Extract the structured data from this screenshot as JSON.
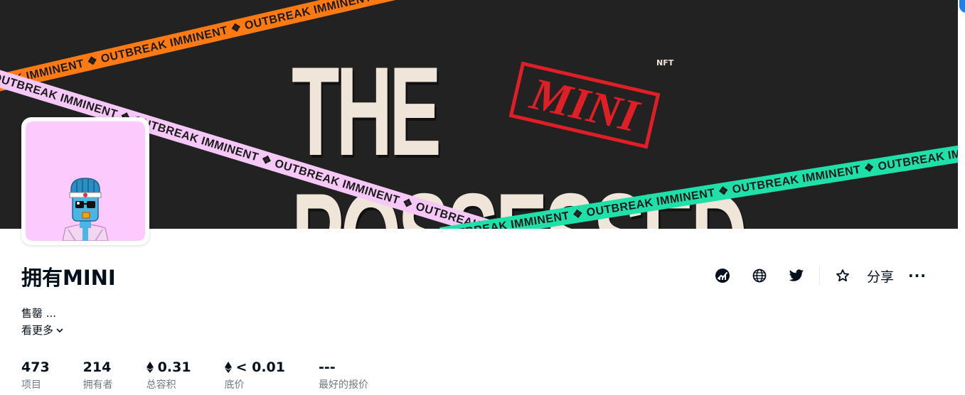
{
  "banner": {
    "title": "THE POSSESSED",
    "nft_mark": "NFT",
    "stamp": "MINI",
    "tape_text": "OUTBREAK IMMINENT ❖ OUTBREAK IMMINENT ❖ OUTBREAK IMMINENT ❖ OUTBREAK IMMINENT ❖ OUTBREAK IMMINENT ❖ OUTBREAK IMMINENT ❖"
  },
  "collection": {
    "title": "拥有MINI",
    "description": "售罄 ...",
    "see_more": "看更多"
  },
  "actions": {
    "activity_icon": "activity-chart-icon",
    "website_icon": "globe-icon",
    "twitter_icon": "twitter-icon",
    "favorite_icon": "star-icon",
    "share_label": "分享",
    "more_label": "···"
  },
  "stats": [
    {
      "value": "473",
      "label": "项目",
      "eth": false
    },
    {
      "value": "214",
      "label": "拥有者",
      "eth": false
    },
    {
      "value": "0.31",
      "label": "总容积",
      "eth": true
    },
    {
      "value": "< 0.01",
      "label": "底价",
      "eth": true
    },
    {
      "value": "---",
      "label": "最好的报价",
      "eth": false
    }
  ],
  "colors": {
    "text": "#04111d",
    "muted": "#707a83",
    "accent": "#2081e2",
    "tape_orange": "#ff7a12",
    "tape_pink": "#f6c8f7",
    "tape_teal": "#1fe0a8",
    "avatar_bg": "#fdcafd"
  }
}
